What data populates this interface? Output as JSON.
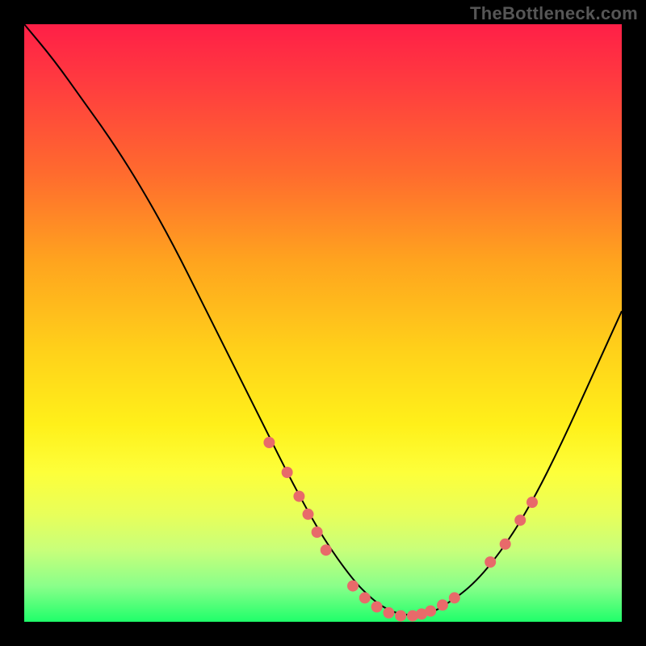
{
  "watermark": "TheBottleneck.com",
  "chart_data": {
    "type": "line",
    "title": "",
    "xlabel": "",
    "ylabel": "",
    "xlim": [
      0,
      100
    ],
    "ylim": [
      0,
      100
    ],
    "series": [
      {
        "name": "curve",
        "x": [
          0,
          5,
          10,
          15,
          20,
          25,
          30,
          35,
          40,
          45,
          50,
          55,
          58,
          60,
          62,
          65,
          68,
          70,
          75,
          80,
          85,
          90,
          95,
          100
        ],
        "y": [
          100,
          94,
          87,
          80,
          72,
          63,
          53,
          43,
          33,
          23,
          14,
          7,
          4,
          2.5,
          1.5,
          1,
          1.5,
          2.5,
          6,
          12,
          20,
          30,
          41,
          52
        ]
      }
    ],
    "markers": [
      {
        "x": 41,
        "y": 30
      },
      {
        "x": 44,
        "y": 25
      },
      {
        "x": 46,
        "y": 21
      },
      {
        "x": 47.5,
        "y": 18
      },
      {
        "x": 49,
        "y": 15
      },
      {
        "x": 50.5,
        "y": 12
      },
      {
        "x": 55,
        "y": 6
      },
      {
        "x": 57,
        "y": 4
      },
      {
        "x": 59,
        "y": 2.5
      },
      {
        "x": 61,
        "y": 1.5
      },
      {
        "x": 63,
        "y": 1
      },
      {
        "x": 65,
        "y": 1
      },
      {
        "x": 66.5,
        "y": 1.3
      },
      {
        "x": 68,
        "y": 1.8
      },
      {
        "x": 70,
        "y": 2.8
      },
      {
        "x": 72,
        "y": 4
      },
      {
        "x": 78,
        "y": 10
      },
      {
        "x": 80.5,
        "y": 13
      },
      {
        "x": 83,
        "y": 17
      },
      {
        "x": 85,
        "y": 20
      }
    ],
    "background_gradient": {
      "top": "#ff1f47",
      "mid": "#ffd21a",
      "bottom": "#1fff6a"
    }
  }
}
